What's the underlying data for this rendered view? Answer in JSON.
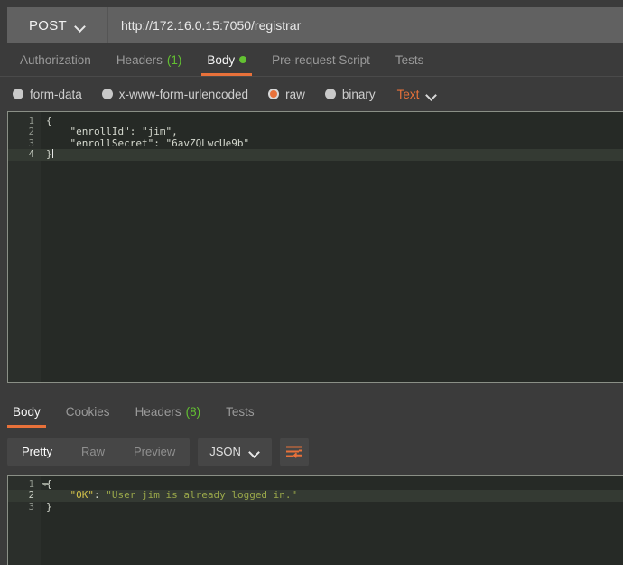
{
  "request": {
    "method": "POST",
    "url": "http://172.16.0.15:7050/registrar",
    "tabs": [
      {
        "label": "Authorization",
        "active": false
      },
      {
        "label": "Headers",
        "count": "(1)",
        "active": false
      },
      {
        "label": "Body",
        "active": true,
        "dot": true
      },
      {
        "label": "Pre-request Script",
        "active": false
      },
      {
        "label": "Tests",
        "active": false
      }
    ],
    "body_types": [
      {
        "label": "form-data",
        "selected": false
      },
      {
        "label": "x-www-form-urlencoded",
        "selected": false
      },
      {
        "label": "raw",
        "selected": true
      },
      {
        "label": "binary",
        "selected": false
      }
    ],
    "raw_format": "Text",
    "body_lines": [
      {
        "n": "1",
        "text": "{"
      },
      {
        "n": "2",
        "text": "    \"enrollId\": \"jim\","
      },
      {
        "n": "3",
        "text": "    \"enrollSecret\": \"6avZQLwcUe9b\""
      },
      {
        "n": "4",
        "text": "}",
        "active": true,
        "caret": true
      }
    ]
  },
  "response": {
    "tabs": [
      {
        "label": "Body",
        "active": true
      },
      {
        "label": "Cookies",
        "active": false
      },
      {
        "label": "Headers",
        "count": "(8)",
        "active": false
      },
      {
        "label": "Tests",
        "active": false
      }
    ],
    "view_modes": [
      {
        "label": "Pretty",
        "active": true
      },
      {
        "label": "Raw",
        "active": false
      },
      {
        "label": "Preview",
        "active": false
      }
    ],
    "format": "JSON",
    "wrap_icon": "word-wrap-icon",
    "body_lines": [
      {
        "n": "1",
        "fold": true,
        "tokens": [
          {
            "t": "{",
            "c": "plain"
          }
        ]
      },
      {
        "n": "2",
        "active": true,
        "tokens": [
          {
            "t": "    ",
            "c": "plain"
          },
          {
            "t": "\"OK\"",
            "c": "key"
          },
          {
            "t": ": ",
            "c": "plain"
          },
          {
            "t": "\"User jim is already logged in.\"",
            "c": "str"
          }
        ]
      },
      {
        "n": "3",
        "tokens": [
          {
            "t": "}",
            "c": "plain"
          }
        ]
      }
    ]
  },
  "colors": {
    "accent": "#e8713a",
    "green": "#63c132",
    "editor_bg": "#262a26",
    "panel_bg": "#3b3b3b"
  }
}
